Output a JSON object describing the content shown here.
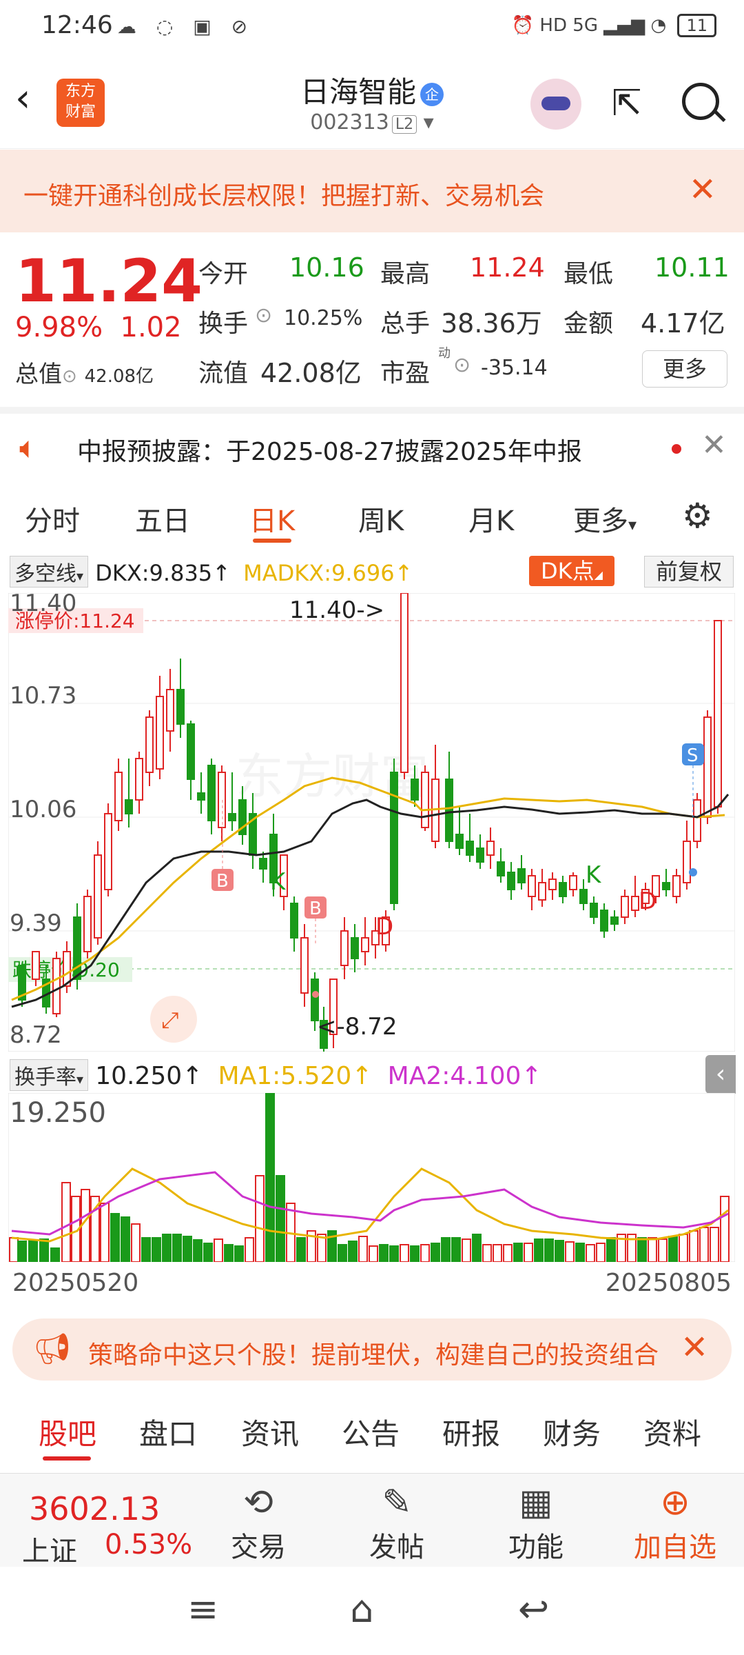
{
  "status_bar": {
    "time": "12:46",
    "signal": "5G",
    "battery": "11"
  },
  "header": {
    "logo_line1": "东方",
    "logo_line2": "财富",
    "stock_name": "日海智能",
    "badge": "企",
    "stock_code": "002313",
    "level": "L2"
  },
  "promo": {
    "text": "一键开通科创成长层权限！把握打新、交易机会"
  },
  "quote": {
    "price": "11.24",
    "change_pct": "9.98%",
    "change_amt": "1.02",
    "open_label": "今开",
    "open": "10.16",
    "high_label": "最高",
    "high": "11.24",
    "low_label": "最低",
    "low": "10.11",
    "turnover_label": "换手",
    "turnover": "10.25%",
    "volume_label": "总手",
    "volume": "38.36万",
    "amount_label": "金额",
    "amount": "4.17亿",
    "mcap_label": "总值",
    "mcap": "42.08亿",
    "float_label": "流值",
    "float_cap": "42.08亿",
    "pe_label": "市盈",
    "pe_sup": "动",
    "pe": "-35.14",
    "more": "更多"
  },
  "notice": {
    "text": "中报预披露：于2025-08-27披露2025年中报"
  },
  "period_tabs": [
    "分时",
    "五日",
    "日K",
    "周K",
    "月K",
    "更多"
  ],
  "indicator": {
    "name": "多空线",
    "dkx": "DKX:9.835",
    "madkx": "MADKX:9.696",
    "dk_btn": "DK点",
    "fq_btn": "前复权"
  },
  "kline": {
    "y_labels": [
      "11.40",
      "10.73",
      "10.06",
      "9.39",
      "8.72"
    ],
    "limit_up": "涨停价:11.24",
    "limit_down": "跌停价:9.20",
    "max_label": "11.40->",
    "min_label": "<-8.72",
    "signals": [
      "B",
      "K",
      "B",
      "D",
      "K",
      "D",
      "S"
    ],
    "watermark": "东方财富"
  },
  "volume": {
    "name": "换手率",
    "value": "10.250",
    "ma1": "MA1:5.520",
    "ma2": "MA2:4.100",
    "y_label": "19.250"
  },
  "chart_data": {
    "type": "bar",
    "title": "",
    "x_start": "20250520",
    "x_end": "20250805",
    "ylim": [
      8.72,
      11.4
    ],
    "limit_up": 11.24,
    "limit_down": 9.2,
    "max": 11.4,
    "min": 8.72
  },
  "dates": {
    "start": "20250520",
    "end": "20250805"
  },
  "banner": {
    "text": "策略命中这只个股！提前埋伏，构建自己的投资组合"
  },
  "bottom_tabs": [
    "股吧",
    "盘口",
    "资讯",
    "公告",
    "研报",
    "财务",
    "资料"
  ],
  "bottom_bar": {
    "index_value": "3602.13",
    "index_name": "上证",
    "index_pct": "0.53%",
    "trade": "交易",
    "post": "发帖",
    "functions": "功能",
    "add_watch": "加自选"
  },
  "colors": {
    "up": "#e02424",
    "down": "#1a9a1a",
    "accent": "#e8531f"
  }
}
